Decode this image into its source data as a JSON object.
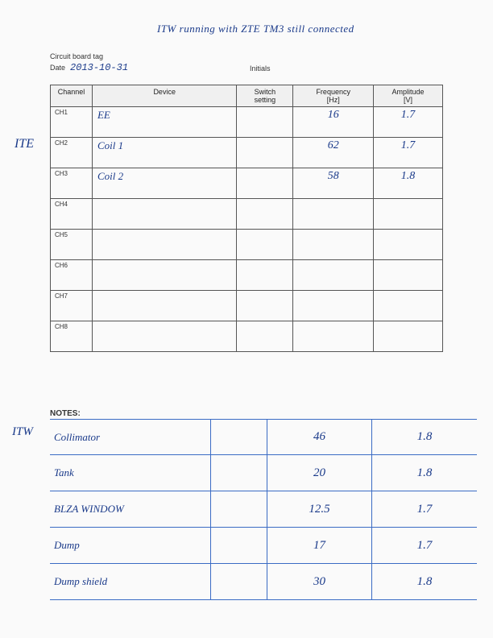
{
  "header": {
    "title": "ITW running with ZTE TM3 still connected"
  },
  "circuit": {
    "label": "Circuit board tag",
    "date_label": "Date",
    "date_value": "2013-10-31",
    "initials_label": "Initials"
  },
  "ite_label": "ITE",
  "itw_label": "ITW",
  "table": {
    "headers": [
      "Channel",
      "Device",
      "Switch setting",
      "Frequency [Hz]",
      "Amplitude [V]"
    ],
    "rows": [
      {
        "channel": "CH1",
        "device": "EE",
        "switch": "",
        "freq": "16",
        "amp": "1.7"
      },
      {
        "channel": "CH2",
        "device": "Coil 1",
        "switch": "",
        "freq": "62",
        "amp": "1.7"
      },
      {
        "channel": "CH3",
        "device": "Coil 2",
        "switch": "",
        "freq": "58",
        "amp": "1.8"
      },
      {
        "channel": "CH4",
        "device": "",
        "switch": "",
        "freq": "",
        "amp": ""
      },
      {
        "channel": "CH5",
        "device": "",
        "switch": "",
        "freq": "",
        "amp": ""
      },
      {
        "channel": "CH6",
        "device": "",
        "switch": "",
        "freq": "",
        "amp": ""
      },
      {
        "channel": "CH7",
        "device": "",
        "switch": "",
        "freq": "",
        "amp": ""
      },
      {
        "channel": "CH8",
        "device": "",
        "switch": "",
        "freq": "",
        "amp": ""
      }
    ]
  },
  "notes_label": "NOTES:",
  "bottom_table": {
    "rows": [
      {
        "device": "Collimator",
        "switch": "",
        "freq": "46",
        "amp": "1.8"
      },
      {
        "device": "Tank",
        "switch": "",
        "freq": "20",
        "amp": "1.8"
      },
      {
        "device": "BLZA WINDOW",
        "switch": "",
        "freq": "12.5",
        "amp": "1.7"
      },
      {
        "device": "Dump",
        "switch": "",
        "freq": "17",
        "amp": "1.7"
      },
      {
        "device": "Dump shield",
        "switch": "",
        "freq": "30",
        "amp": "1.8"
      }
    ]
  }
}
